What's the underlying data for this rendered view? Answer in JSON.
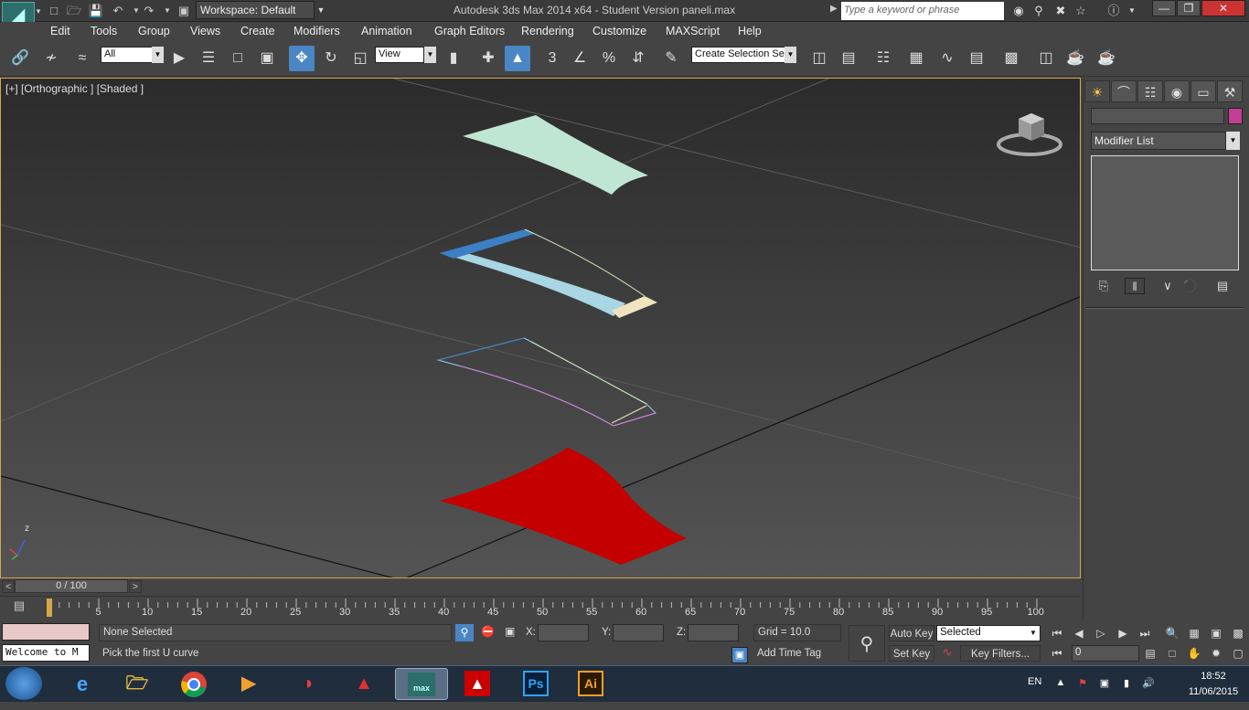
{
  "app": {
    "logo": "MAX",
    "workspace": "Workspace: Default",
    "window_title": "Autodesk 3ds Max  2014 x64  - Student Version    paneli.max",
    "search_placeholder": "Type a keyword or phrase"
  },
  "menu": [
    "Edit",
    "Tools",
    "Group",
    "Views",
    "Create",
    "Modifiers",
    "Animation",
    "Graph Editors",
    "Rendering",
    "Customize",
    "MAXScript",
    "Help"
  ],
  "toolbar": {
    "filter_value": "All",
    "refcoord_value": "View",
    "selection_set_value": "Create Selection Se",
    "snap_3_label": "3"
  },
  "viewport": {
    "label": "[+] [Orthographic ] [Shaded ]",
    "axis_z": "z",
    "objects": [
      {
        "name": "panel-mint",
        "color": "#bfe6d2"
      },
      {
        "name": "panel-blue-cream",
        "color": "#3d7fc4"
      },
      {
        "name": "curves-outline",
        "color": "#9ad0f0"
      },
      {
        "name": "panel-red",
        "color": "#c40000"
      }
    ]
  },
  "command_panel": {
    "modifier_list": "Modifier List",
    "object_color": "#c43d96"
  },
  "timeline": {
    "frame_display": "0 / 100",
    "ticks": [
      "0",
      "5",
      "10",
      "15",
      "20",
      "25",
      "30",
      "35",
      "40",
      "45",
      "50",
      "55",
      "60",
      "65",
      "70",
      "75",
      "80",
      "85",
      "90",
      "95",
      "100"
    ]
  },
  "status": {
    "script_listener": "Welcome to M",
    "selection": "None Selected",
    "prompt": "Pick the first U curve",
    "x_label": "X:",
    "y_label": "Y:",
    "z_label": "Z:",
    "grid": "Grid = 10.0",
    "add_time_tag": "Add Time Tag",
    "auto_key": "Auto Key",
    "set_key": "Set Key",
    "key_mode": "Selected",
    "key_filters": "Key Filters...",
    "frame": "0"
  },
  "taskbar": {
    "apps": [
      "ie",
      "explorer",
      "chrome",
      "media",
      "popcorn",
      "sketchup",
      "3dsmax",
      "autocad",
      "photoshop",
      "illustrator"
    ],
    "max_label": "max",
    "ps_label": "Ps",
    "ai_label": "Ai",
    "language": "EN",
    "time": "18:52",
    "date": "11/06/2015"
  }
}
